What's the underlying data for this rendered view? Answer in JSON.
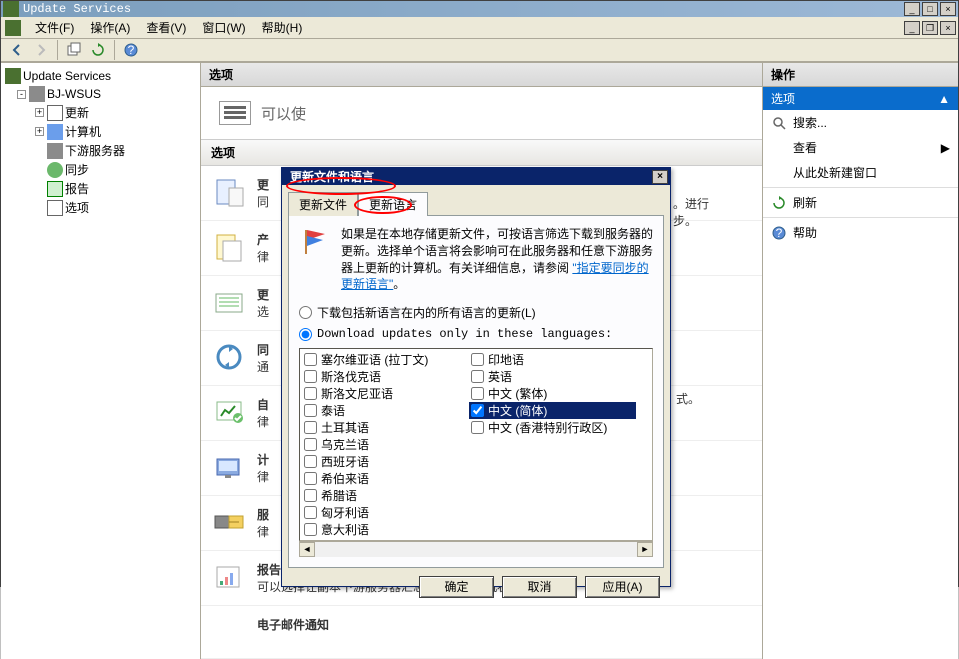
{
  "window": {
    "title": "Update Services"
  },
  "menus": {
    "file": "文件(F)",
    "action": "操作(A)",
    "view": "查看(V)",
    "window": "窗口(W)",
    "help": "帮助(H)"
  },
  "extra_winbtns": {
    "restore": "❐",
    "close": "×"
  },
  "tree": {
    "root": "Update Services",
    "server": "BJ-WSUS",
    "nodes": {
      "updates": "更新",
      "computers": "计算机",
      "downstream": "下游服务器",
      "sync": "同步",
      "report": "报告",
      "options": "选项"
    }
  },
  "center": {
    "header": "选项",
    "banner": "可以使",
    "sub_header": "选项",
    "obscured_right": "。进行\n步。",
    "obscured_right2": "式。",
    "items": [
      {
        "title": "更",
        "desc": "同"
      },
      {
        "title": "产",
        "desc": "律"
      },
      {
        "title": "更",
        "desc": "选"
      },
      {
        "title": "同",
        "desc": "通"
      },
      {
        "title": "自",
        "desc": "律"
      },
      {
        "title": "计",
        "desc": "律"
      },
      {
        "title": "服",
        "desc": "律"
      }
    ],
    "report": {
      "title": "报告汇总",
      "desc": "可以选择让副本下游服务器汇总更新和计算机状态。"
    },
    "email": {
      "title": "电子邮件通知"
    }
  },
  "actions": {
    "header": "操作",
    "group": "选项",
    "search": "搜索...",
    "view": "查看",
    "newwin": "从此处新建窗口",
    "refresh": "刷新",
    "help": "帮助"
  },
  "dialog": {
    "title": "更新文件和语言",
    "tabs": {
      "files": "更新文件",
      "langs": "更新语言"
    },
    "info": "如果是在本地存储更新文件，可按语言筛选下载到服务器的更新。选择单个语言将会影响可在此服务器和任意下游服务器上更新的计算机。有关详细信息，请参阅",
    "link": "\"指定要同步的更新语言\"",
    "radio_all": "下载包括新语言在内的所有语言的更新(L)",
    "radio_sel": "Download updates only in these languages:",
    "langs_left": [
      "塞尔维亚语 (拉丁文)",
      "斯洛伐克语",
      "斯洛文尼亚语",
      "泰语",
      "土耳其语",
      "乌克兰语",
      "西班牙语",
      "希伯来语",
      "希腊语",
      "匈牙利语",
      "意大利语"
    ],
    "langs_right": [
      "印地语",
      "英语",
      "中文 (繁体)",
      "中文 (简体)",
      "中文 (香港特别行政区)"
    ],
    "selected_lang": "中文 (简体)",
    "checked_lang": "中文 (简体)",
    "buttons": {
      "ok": "确定",
      "cancel": "取消",
      "apply": "应用(A)"
    }
  }
}
